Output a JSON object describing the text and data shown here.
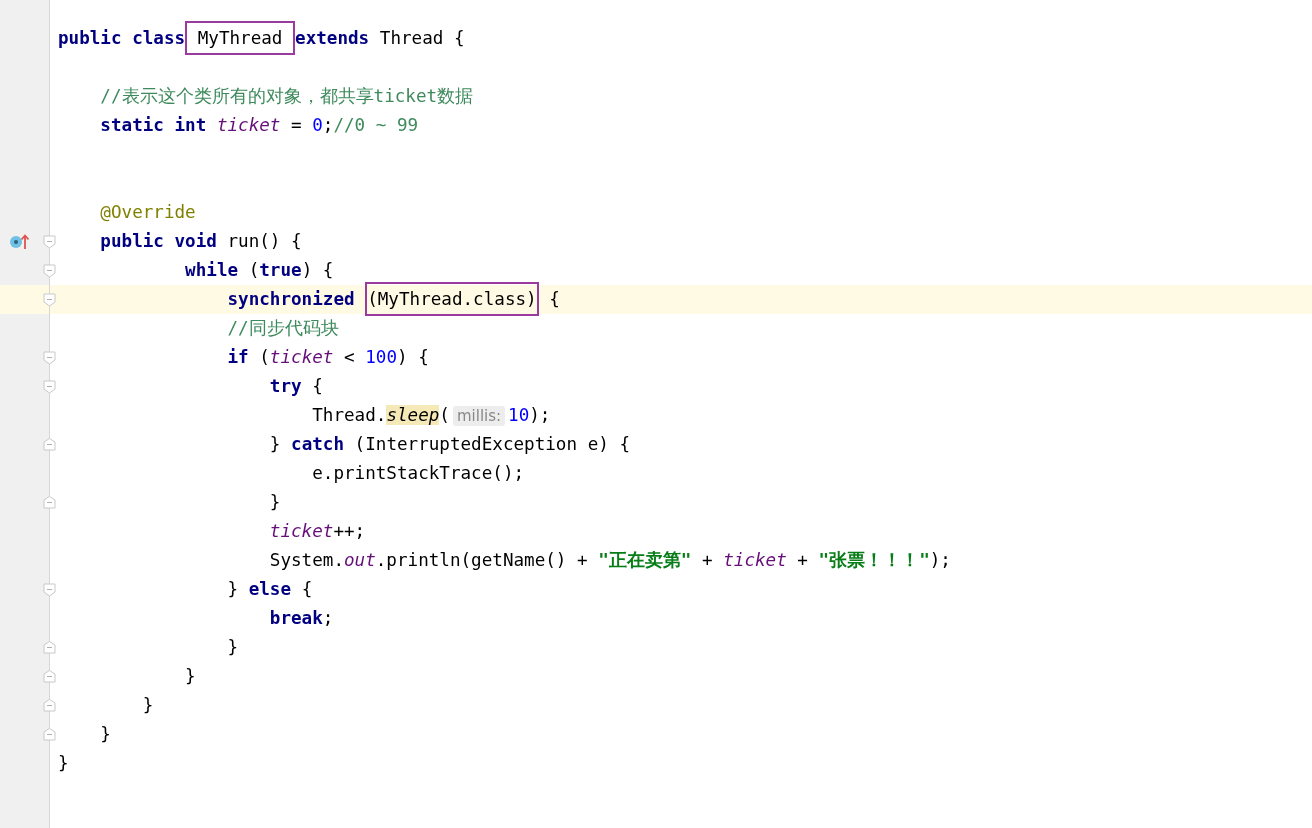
{
  "editor": {
    "lines": [
      {
        "current": false
      },
      {
        "current": false,
        "tokens": [
          {
            "kind": "keyword",
            "text": "public class"
          },
          {
            "kind": "box",
            "tokens": [
              {
                "kind": "plain",
                "text": " MyThread "
              }
            ]
          },
          {
            "kind": "keyword",
            "text": "extends"
          },
          {
            "kind": "plain",
            "text": " Thread {"
          }
        ]
      },
      {
        "current": false
      },
      {
        "current": false,
        "tokens": [
          {
            "kind": "comment",
            "text": "    //表示这个类所有的对象，都共享ticket数据"
          }
        ]
      },
      {
        "current": false,
        "tokens": [
          {
            "kind": "keyword",
            "text": "    static int "
          },
          {
            "kind": "field",
            "text": "ticket"
          },
          {
            "kind": "plain",
            "text": " = "
          },
          {
            "kind": "number",
            "text": "0"
          },
          {
            "kind": "plain",
            "text": ";"
          },
          {
            "kind": "comment",
            "text": "//0 ~ 99"
          }
        ]
      },
      {
        "current": false
      },
      {
        "current": false
      },
      {
        "current": false,
        "tokens": [
          {
            "kind": "annotation",
            "text": "    @Override"
          }
        ]
      },
      {
        "current": false,
        "fold": {
          "kind": "start"
        },
        "gutter_icon": {
          "kind": "override"
        },
        "tokens": [
          {
            "kind": "keyword",
            "text": "    public void"
          },
          {
            "kind": "plain",
            "text": " run() {"
          }
        ]
      },
      {
        "current": false,
        "fold": {
          "kind": "start"
        },
        "tokens": [
          {
            "kind": "keyword",
            "text": "            while"
          },
          {
            "kind": "plain",
            "text": " ("
          },
          {
            "kind": "keyword",
            "text": "true"
          },
          {
            "kind": "plain",
            "text": ") {"
          }
        ]
      },
      {
        "current": true,
        "fold": {
          "kind": "start"
        },
        "tokens": [
          {
            "kind": "keyword",
            "text": "                synchronized "
          },
          {
            "kind": "box",
            "tokens": [
              {
                "kind": "plain",
                "text": "(MyThread.class)"
              }
            ]
          },
          {
            "kind": "plain",
            "text": " {"
          }
        ]
      },
      {
        "current": false,
        "tokens": [
          {
            "kind": "comment",
            "text": "                //同步代码块"
          }
        ]
      },
      {
        "current": false,
        "fold": {
          "kind": "start"
        },
        "tokens": [
          {
            "kind": "keyword",
            "text": "                if"
          },
          {
            "kind": "plain",
            "text": " ("
          },
          {
            "kind": "field",
            "text": "ticket"
          },
          {
            "kind": "plain",
            "text": " < "
          },
          {
            "kind": "number",
            "text": "100"
          },
          {
            "kind": "plain",
            "text": ") {"
          }
        ]
      },
      {
        "current": false,
        "fold": {
          "kind": "start"
        },
        "tokens": [
          {
            "kind": "keyword",
            "text": "                    try"
          },
          {
            "kind": "plain",
            "text": " {"
          }
        ]
      },
      {
        "current": false,
        "tokens": [
          {
            "kind": "plain",
            "text": "                        Thread."
          },
          {
            "kind": "usage",
            "text": "sleep"
          },
          {
            "kind": "plain",
            "text": "("
          },
          {
            "kind": "hint",
            "text": "millis:"
          },
          {
            "kind": "number",
            "text": "10"
          },
          {
            "kind": "plain",
            "text": ");"
          }
        ]
      },
      {
        "current": false,
        "fold": {
          "kind": "end"
        },
        "tokens": [
          {
            "kind": "plain",
            "text": "                    } "
          },
          {
            "kind": "keyword",
            "text": "catch"
          },
          {
            "kind": "plain",
            "text": " (InterruptedException e) {"
          }
        ]
      },
      {
        "current": false,
        "tokens": [
          {
            "kind": "plain",
            "text": "                        e.printStackTrace();"
          }
        ]
      },
      {
        "current": false,
        "fold": {
          "kind": "end"
        },
        "tokens": [
          {
            "kind": "plain",
            "text": "                    }"
          }
        ]
      },
      {
        "current": false,
        "tokens": [
          {
            "kind": "field",
            "text": "                    ticket"
          },
          {
            "kind": "plain",
            "text": "++;"
          }
        ]
      },
      {
        "current": false,
        "tokens": [
          {
            "kind": "plain",
            "text": "                    System."
          },
          {
            "kind": "field",
            "text": "out"
          },
          {
            "kind": "plain",
            "text": ".println(getName() + "
          },
          {
            "kind": "string",
            "text": "\"正在卖第\""
          },
          {
            "kind": "plain",
            "text": " + "
          },
          {
            "kind": "field",
            "text": "ticket"
          },
          {
            "kind": "plain",
            "text": " + "
          },
          {
            "kind": "string",
            "text": "\"张票！！！\""
          },
          {
            "kind": "plain",
            "text": ");"
          }
        ]
      },
      {
        "current": false,
        "fold": {
          "kind": "start"
        },
        "tokens": [
          {
            "kind": "plain",
            "text": "                } "
          },
          {
            "kind": "keyword",
            "text": "else"
          },
          {
            "kind": "plain",
            "text": " {"
          }
        ]
      },
      {
        "current": false,
        "tokens": [
          {
            "kind": "keyword",
            "text": "                    break"
          },
          {
            "kind": "plain",
            "text": ";"
          }
        ]
      },
      {
        "current": false,
        "fold": {
          "kind": "end"
        },
        "tokens": [
          {
            "kind": "plain",
            "text": "                }"
          }
        ]
      },
      {
        "current": false,
        "fold": {
          "kind": "end"
        },
        "tokens": [
          {
            "kind": "plain",
            "text": "            }"
          }
        ]
      },
      {
        "current": false,
        "fold": {
          "kind": "end"
        },
        "tokens": [
          {
            "kind": "plain",
            "text": "        }"
          }
        ]
      },
      {
        "current": false,
        "fold": {
          "kind": "end"
        },
        "tokens": [
          {
            "kind": "plain",
            "text": "    }"
          }
        ]
      },
      {
        "current": false,
        "tokens": [
          {
            "kind": "plain",
            "text": "}"
          }
        ]
      },
      {
        "current": false
      }
    ]
  }
}
